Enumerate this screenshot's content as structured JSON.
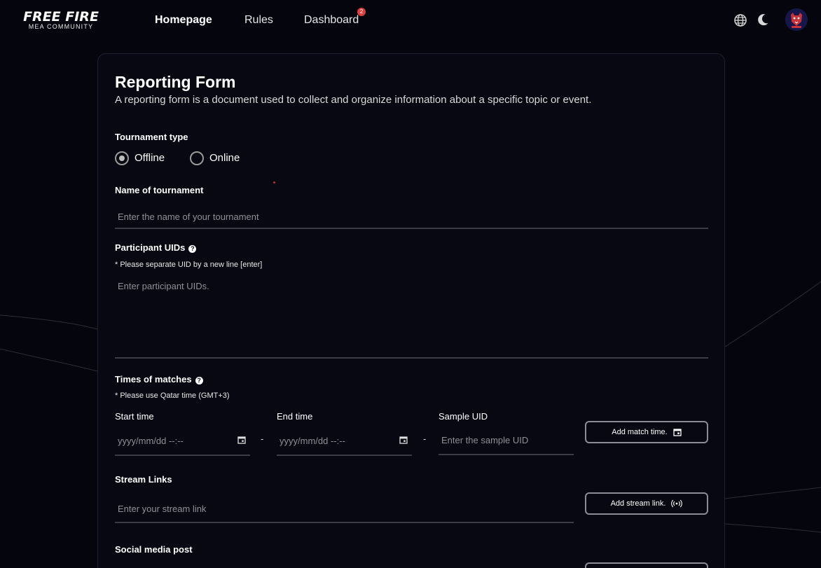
{
  "header": {
    "logo_main": "FREE FIRE",
    "logo_sub": "MEA COMMUNITY",
    "nav": {
      "home": "Homepage",
      "rules": "Rules",
      "dashboard": "Dashboard"
    },
    "dashboard_badge": "2",
    "icons": {
      "language": "globe-icon",
      "theme": "moon-icon",
      "profile": "avatar"
    }
  },
  "form": {
    "title": "Reporting Form",
    "subtitle": "A reporting form is a document used to collect and organize information about a specific topic or event.",
    "tournament_type": {
      "label": "Tournament type",
      "options": [
        "Offline",
        "Online"
      ],
      "selected": "Offline"
    },
    "tournament_name": {
      "label": "Name of tournament",
      "placeholder": "Enter the name of your tournament",
      "value": ""
    },
    "participant_uids": {
      "label": "Participant UIDs",
      "note": "* Please separate UID by a new line [enter]",
      "placeholder": "Enter participant UIDs.",
      "value": ""
    },
    "match_times": {
      "label": "Times of matches",
      "note": "* Please use Qatar time (GMT+3)",
      "start_label": "Start time",
      "start_placeholder": "yyyy/mm/dd --:--",
      "separator": "-",
      "end_label": "End time",
      "end_placeholder": "yyyy/mm/dd --:--",
      "sample_label": "Sample UID",
      "sample_placeholder": "Enter the sample UID",
      "add_button": "Add match time."
    },
    "stream_links": {
      "label": "Stream Links",
      "placeholder": "Enter your stream link",
      "add_button": "Add stream link."
    },
    "social_media": {
      "label": "Social media post"
    }
  },
  "colors": {
    "background": "#05060d",
    "card": "#070811",
    "badge": "#d94040",
    "field_border": "#3a3c48"
  }
}
